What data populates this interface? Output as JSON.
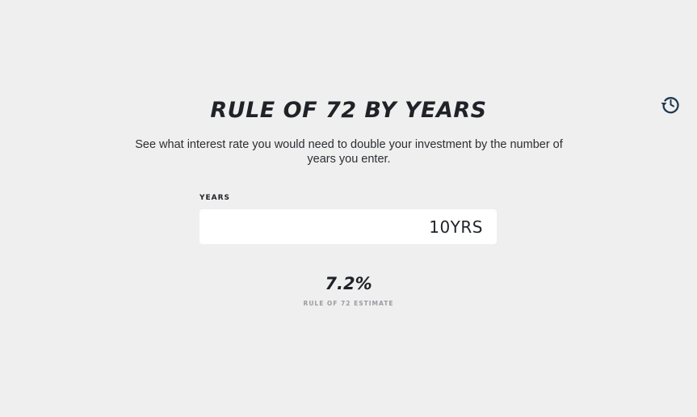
{
  "calculator": {
    "title": "RULE OF 72 BY YEARS",
    "description": "See what interest rate you would need to double your investment by the number of years you enter.",
    "reset_icon": "reset-icon",
    "years_label": "YEARS",
    "years_value": "10YRS",
    "result_value": "7.2%",
    "result_label": "RULE OF 72 ESTIMATE"
  },
  "colors": {
    "background": "#efefef",
    "text": "#1f2227",
    "muted": "#9a9ca2",
    "input_bg": "#ffffff",
    "icon": "#1e3a52"
  }
}
